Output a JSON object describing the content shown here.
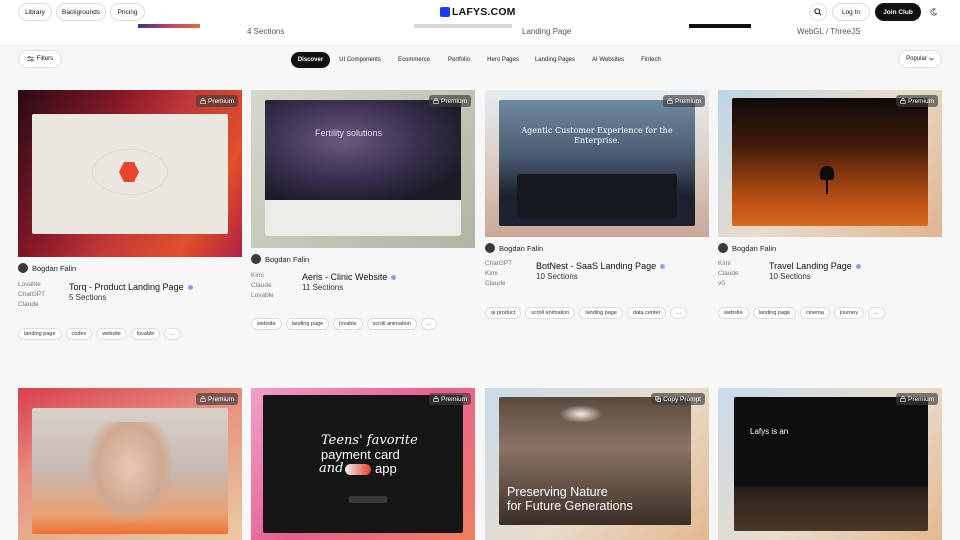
{
  "nav": {
    "left_buttons": [
      "Library",
      "Backgrounds",
      "Pricing"
    ],
    "logo": "LAFYS.COM",
    "login": "Log In",
    "join": "Join Club"
  },
  "top_strip": {
    "item1_sections": "4 Sections",
    "item2_title": "Landing Page",
    "item3_title": "WebGL / ThreeJS"
  },
  "filters": {
    "filters_label": "Filters",
    "tabs": [
      "Discover",
      "UI Components",
      "Ecommerce",
      "Portfolio",
      "Hero Pages",
      "Landing Pages",
      "AI Websites",
      "Fintech"
    ],
    "active_tab": "Discover",
    "sort": "Popular"
  },
  "cards": [
    {
      "badge": "Premium",
      "author": "Bogdan Falin",
      "tools": [
        "Lovable",
        "ChatGPT",
        "Claude"
      ],
      "title": "Torq - Product Landing Page",
      "sections": "5 Sections",
      "tags": [
        "landing page",
        "codex",
        "website",
        "lovable",
        "..."
      ]
    },
    {
      "badge": "Premium",
      "author": "Bogdan Falin",
      "tools": [
        "Kimi",
        "Claude",
        "Lovable"
      ],
      "title": "Aeris - Clinic Website",
      "sections": "11 Sections",
      "tags": [
        "website",
        "landing page",
        "lovable",
        "scroll animation",
        "..."
      ],
      "screen_text": "Fertility solutions"
    },
    {
      "badge": "Premium",
      "author": "Bogdan Falin",
      "tools": [
        "ChatGPT",
        "Kimi",
        "Claude"
      ],
      "title": "BotNest - SaaS Landing Page",
      "sections": "10 Sections",
      "tags": [
        "ai product",
        "scroll animation",
        "landing page",
        "data center",
        "..."
      ],
      "screen_text": "Agentic Customer Experience for the Enterprise."
    },
    {
      "badge": "Premium",
      "author": "Bogdan Falin",
      "tools": [
        "Kimi",
        "Claude",
        "v0"
      ],
      "title": "Travel Landing Page",
      "sections": "10 Sections",
      "tags": [
        "website",
        "landing page",
        "cinema",
        "journey",
        "..."
      ]
    },
    {
      "badge": "Premium"
    },
    {
      "badge": "Premium",
      "screen_text_1": "Teens' favorite",
      "screen_text_2": "payment card",
      "screen_text_3": "and",
      "screen_text_4": "app"
    },
    {
      "badge": "Copy Prompt",
      "screen_text_1": "Preserving Nature",
      "screen_text_2": "for Future Generations"
    },
    {
      "badge": "Premium",
      "screen_text": "Lafys is an"
    }
  ],
  "colors": {
    "accent_dot": "#8aa0f0",
    "join_bg": "#111111",
    "logo": "#1a3cff"
  }
}
